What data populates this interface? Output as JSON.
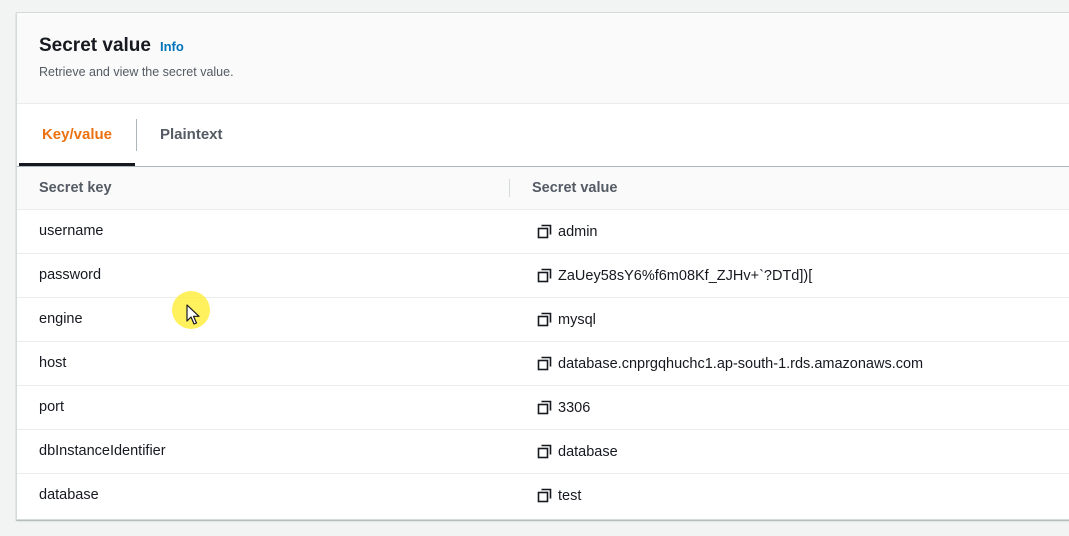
{
  "section": {
    "title": "Secret value",
    "info_label": "Info",
    "subtitle": "Retrieve and view the secret value."
  },
  "tabs": [
    {
      "label": "Key/value",
      "active": true
    },
    {
      "label": "Plaintext",
      "active": false
    }
  ],
  "table": {
    "columns": [
      "Secret key",
      "Secret value"
    ],
    "rows": [
      {
        "key": "username",
        "value": "admin"
      },
      {
        "key": "password",
        "value": "ZaUey58sY6%f6m08Kf_ZJHv+`?DTd])["
      },
      {
        "key": "engine",
        "value": "mysql"
      },
      {
        "key": "host",
        "value": "database.cnprgqhuchc1.ap-south-1.rds.amazonaws.com"
      },
      {
        "key": "port",
        "value": "3306"
      },
      {
        "key": "dbInstanceIdentifier",
        "value": "database"
      },
      {
        "key": "database",
        "value": "test"
      }
    ]
  },
  "icons": {
    "copy": "copy-icon",
    "cursor": "mouse-pointer-icon"
  },
  "colors": {
    "active_tab": "#ec7211",
    "info_link": "#0073bb",
    "cursor_highlight": "#ffeb28"
  }
}
